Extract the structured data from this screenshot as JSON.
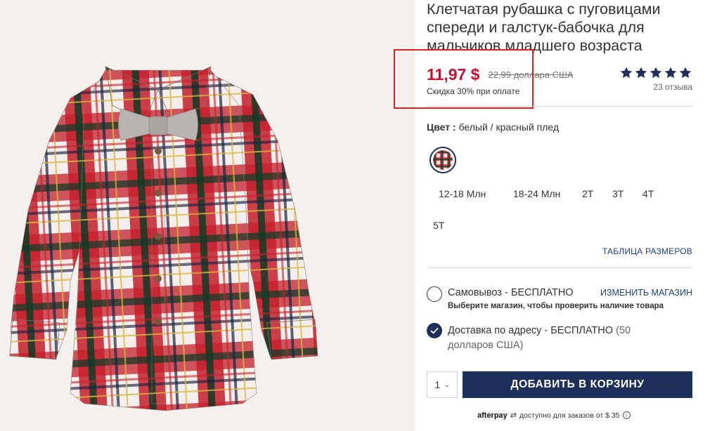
{
  "product": {
    "title": "Клетчатая рубашка с пуговицами спереди и галстук-бабочка для мальчиков младшего возраста",
    "image_alt": "Красно-белая клетчатая рубашка с серой бабочкой"
  },
  "price": {
    "current": "11,97 $",
    "original": "22,99 доллара США",
    "discount_note": "Скидка 30% при оплате"
  },
  "rating": {
    "stars": 5,
    "reviews_text": "23 отзыва"
  },
  "color": {
    "label": "Цвет :",
    "value": "белый / красный плед"
  },
  "sizes": [
    "12-18 Млн",
    "18-24 Млн",
    "2T",
    "3T",
    "4T",
    "5T"
  ],
  "size_chart_link": "ТАБЛИЦА РАЗМЕРОВ",
  "fulfillment": {
    "pickup": {
      "label": "Самовывоз - БЕСПЛАТНО",
      "change_link": "ИЗМЕНИТЬ МАГАЗИН",
      "subtext": "Выберите магазин, чтобы проверить наличие товара",
      "selected": false
    },
    "delivery": {
      "label": "Доставка по адресу - БЕСПЛАТНО",
      "note": "(50 долларов США)",
      "selected": true
    }
  },
  "cart": {
    "quantity": "1",
    "add_button": "ДОБАВИТЬ В КОРЗИНУ"
  },
  "afterpay": {
    "brand": "afterpay",
    "text": "доступно для заказов от $ 35"
  },
  "colors": {
    "brand_navy": "#1d2f5b",
    "sale_red": "#c8102e",
    "highlight_red": "#e0201c"
  }
}
